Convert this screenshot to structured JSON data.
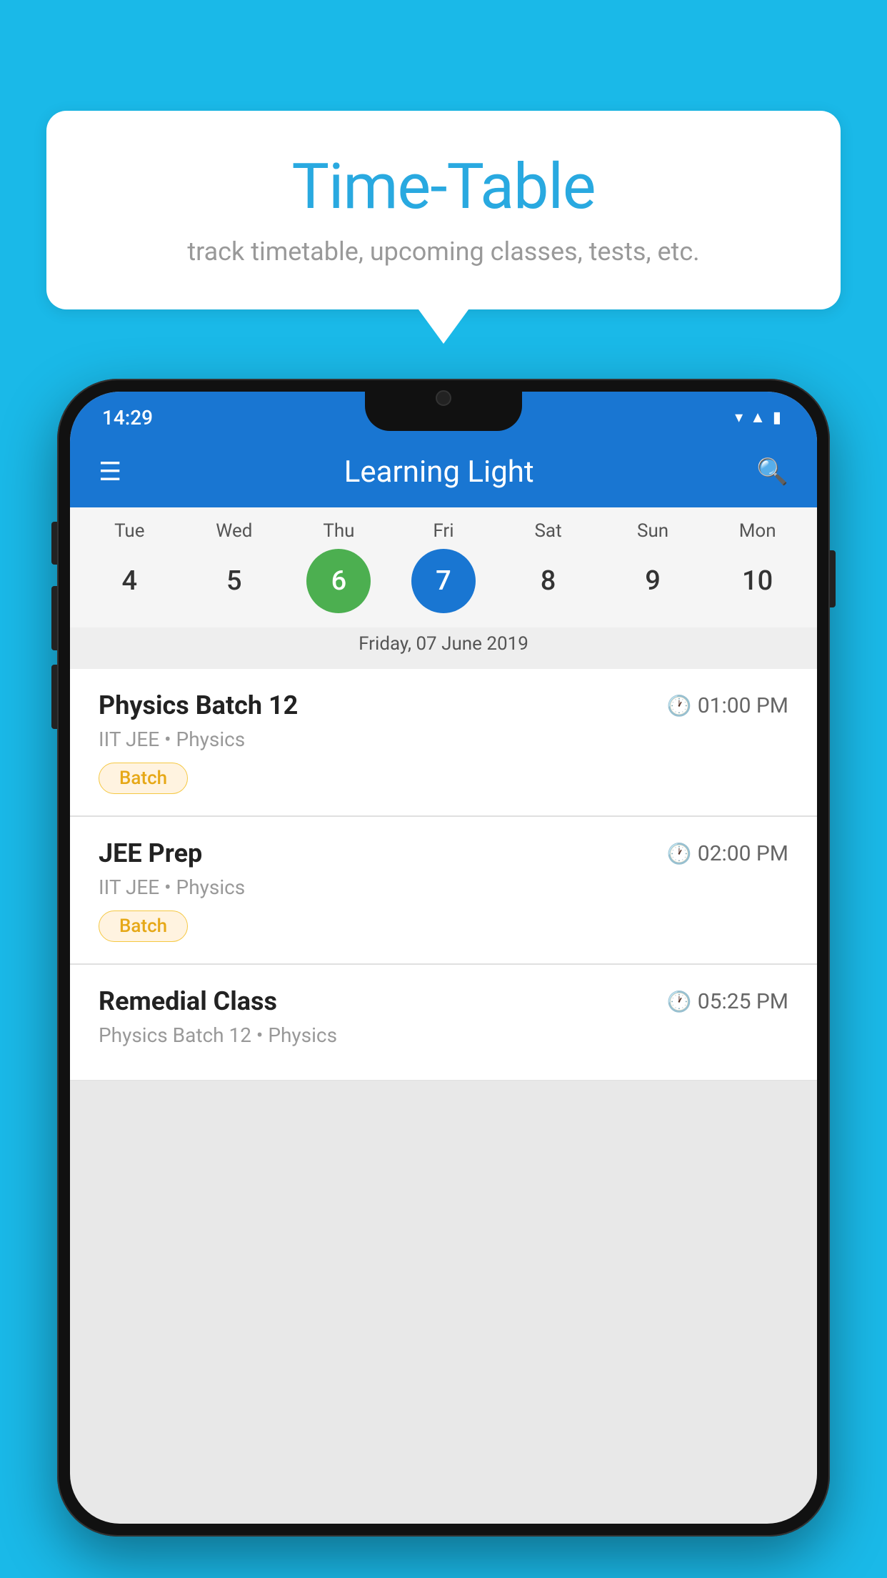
{
  "background_color": "#1ab9e8",
  "bubble": {
    "title": "Time-Table",
    "subtitle": "track timetable, upcoming classes, tests, etc."
  },
  "phone": {
    "status_bar": {
      "time": "14:29",
      "icons": [
        "wifi",
        "signal",
        "battery"
      ]
    },
    "app_bar": {
      "title": "Learning Light",
      "menu_icon": "☰",
      "search_icon": "🔍"
    },
    "calendar": {
      "days": [
        {
          "label": "Tue",
          "number": "4"
        },
        {
          "label": "Wed",
          "number": "5"
        },
        {
          "label": "Thu",
          "number": "6",
          "state": "today"
        },
        {
          "label": "Fri",
          "number": "7",
          "state": "selected"
        },
        {
          "label": "Sat",
          "number": "8"
        },
        {
          "label": "Sun",
          "number": "9"
        },
        {
          "label": "Mon",
          "number": "10"
        }
      ],
      "selected_date_label": "Friday, 07 June 2019"
    },
    "classes": [
      {
        "name": "Physics Batch 12",
        "time": "01:00 PM",
        "meta": "IIT JEE • Physics",
        "tag": "Batch"
      },
      {
        "name": "JEE Prep",
        "time": "02:00 PM",
        "meta": "IIT JEE • Physics",
        "tag": "Batch"
      },
      {
        "name": "Remedial Class",
        "time": "05:25 PM",
        "meta": "Physics Batch 12 • Physics",
        "tag": null
      }
    ]
  }
}
